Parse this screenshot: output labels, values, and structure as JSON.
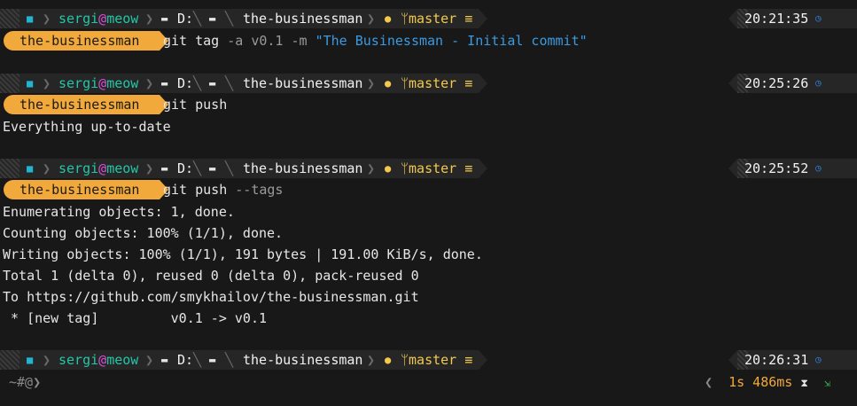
{
  "prompt": {
    "user": "sergi",
    "at": "@",
    "host": "meow",
    "drive": "D:",
    "dir": "the-businessman",
    "branch": "master",
    "status": "≡",
    "pill": "the-businessman",
    "icons": {
      "os": "windows-icon",
      "folder": "folder-icon",
      "git": "github-icon",
      "clock": "clock-icon"
    }
  },
  "blocks": [
    {
      "time": "20:21:35",
      "cmd": "git tag",
      "args": " -a v0.1 -m ",
      "str": "\"The Businessman - Initial commit\"",
      "output": []
    },
    {
      "time": "20:25:26",
      "cmd": "git push",
      "args": "",
      "str": "",
      "output": [
        "Everything up-to-date"
      ]
    },
    {
      "time": "20:25:52",
      "cmd": "git push",
      "args": " --tags",
      "str": "",
      "output": [
        "Enumerating objects: 1, done.",
        "Counting objects: 100% (1/1), done.",
        "Writing objects: 100% (1/1), 191 bytes | 191.00 KiB/s, done.",
        "Total 1 (delta 0), reused 0 (delta 0), pack-reused 0",
        "To https://github.com/smykhailov/the-businessman.git",
        " * [new tag]         v0.1 -> v0.1"
      ]
    },
    {
      "time": "20:26:31",
      "cmd": "",
      "args": "",
      "str": "",
      "output": []
    }
  ],
  "footer": {
    "input_prompt": "~#@❯",
    "chevron": "❮",
    "duration": "1s 486ms",
    "hourglass": "⧗",
    "exit_glyph": "⇲"
  },
  "colors": {
    "background": "#181818",
    "bar": "#262626",
    "pill": "#f2a93b",
    "user": "#22c7a8",
    "branch": "#f2c94c",
    "string": "#3b9ae1"
  }
}
